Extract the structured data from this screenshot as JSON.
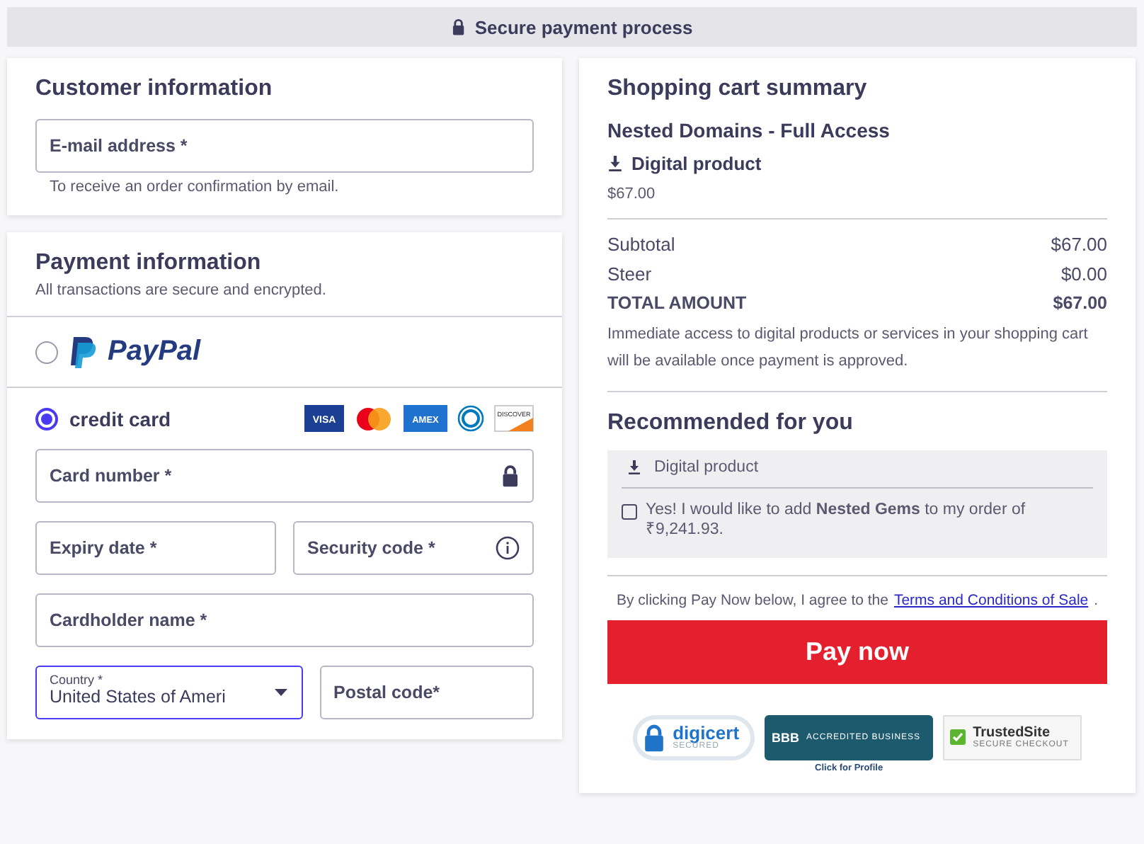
{
  "banner": {
    "text": "Secure payment process"
  },
  "customer": {
    "title": "Customer information",
    "email": {
      "placeholder": "E-mail address *"
    },
    "hint": "To receive an order confirmation by email."
  },
  "payment": {
    "title": "Payment information",
    "subtitle": "All transactions are secure and encrypted.",
    "methods": [
      {
        "kind": "paypal",
        "label": "PayPal",
        "selected": false
      },
      {
        "kind": "card",
        "label": "credit card",
        "selected": true,
        "brands": [
          {
            "kind": "visa",
            "label": "VISA"
          },
          {
            "kind": "mastercard"
          },
          {
            "kind": "amex",
            "label": "AMEX"
          },
          {
            "kind": "diners"
          },
          {
            "kind": "discover",
            "label": "DISCOVER"
          }
        ]
      }
    ],
    "rows": [
      [
        {
          "kind": "locked",
          "placeholder": "Card number *"
        }
      ],
      [
        {
          "kind": "input",
          "placeholder": "Expiry date *"
        },
        {
          "kind": "help",
          "placeholder": "Security code *"
        }
      ],
      [
        {
          "kind": "input",
          "placeholder": "Cardholder name *"
        }
      ],
      [
        {
          "kind": "select",
          "label": "Country *",
          "value": "United States of Ameri",
          "focused": true
        },
        {
          "kind": "input",
          "placeholder": "Postal code*"
        }
      ]
    ]
  },
  "summary": {
    "title": "Shopping cart summary",
    "product": "Nested Domains - Full Access",
    "product_type": "Digital product",
    "price": "$67.00",
    "lines": [
      {
        "kind": "normal",
        "label": "Subtotal",
        "value": "$67.00"
      },
      {
        "kind": "normal",
        "label": "Steer",
        "value": "$0.00"
      },
      {
        "kind": "total",
        "label": "TOTAL AMOUNT",
        "value": "$67.00"
      }
    ],
    "note": "Immediate access to digital products or services in your shopping cart will be available once payment is approved.",
    "recommended": {
      "title": "Recommended for you",
      "type": "Digital product",
      "offer": "Yes! I would like to add **Nested Gems** to my order of ₹9,241.93.",
      "checked": false
    },
    "terms": {
      "text": "By clicking Pay Now below, I agree to the",
      "link": "Terms and Conditions of Sale",
      "end": "."
    },
    "button": "Pay now",
    "badges": [
      {
        "kind": "digicert",
        "name": "digicert",
        "sub": "SECURED"
      },
      {
        "kind": "bbb",
        "name": "BBB",
        "sub": "ACCREDITED BUSINESS",
        "caption": "Click for Profile"
      },
      {
        "kind": "trustedsite",
        "name": "TrustedSite",
        "sub": "SECURE CHECKOUT"
      }
    ]
  }
}
